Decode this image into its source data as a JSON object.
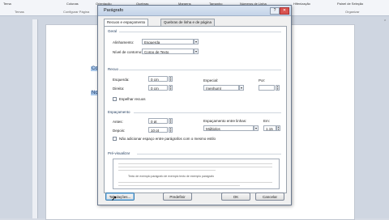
{
  "ribbon": {
    "tools": [
      "Tema",
      "Colunas",
      "Orientação",
      "Quebras",
      "Margens",
      "Tamanho",
      "Números de Linha",
      "Hifenização",
      "Painel de Seleção"
    ],
    "groups": [
      "Temas",
      "Configurar Página",
      "Organizar"
    ]
  },
  "document": {
    "sel1": "Com",
    "sel2": "No l"
  },
  "dialog": {
    "title": "Parágrafo",
    "help_btn": "?",
    "close_btn": "✕",
    "tabs": [
      "Recuos e espaçamento",
      "Quebras de linha e de página"
    ],
    "general": {
      "section": "Geral",
      "align_label": "Alinhamento:",
      "align_value": "Esquerda",
      "level_label": "Nível de contorno:",
      "level_value": "Corpo de Texto"
    },
    "indent": {
      "section": "Recuo",
      "left_label": "Esquerda:",
      "left_value": "0 cm",
      "right_label": "Direita:",
      "right_value": "0 cm",
      "special_label": "Especial:",
      "special_value": "(nenhum)",
      "by_label": "Por:",
      "by_value": "",
      "mirror_label": "Espelhar recuos"
    },
    "spacing": {
      "section": "Espaçamento",
      "before_label": "Antes:",
      "before_value": "0 pt",
      "after_label": "Depois:",
      "after_value": "10 pt",
      "line_label": "Espaçamento entre linhas:",
      "line_value": "Múltiplos",
      "em_label": "Em:",
      "em_value": "1,15",
      "no_space_label": "Não adicionar espaço entre parágrafos com o mesmo estilo"
    },
    "preview": {
      "section": "Pré-visualizar",
      "sample": "Texto de exemplo parágrafo de exemplo texto de exemplo parágrafo"
    },
    "buttons": {
      "tabs": "Tabulações...",
      "default": "Predefinir",
      "ok": "OK",
      "cancel": "Cancelar"
    }
  }
}
